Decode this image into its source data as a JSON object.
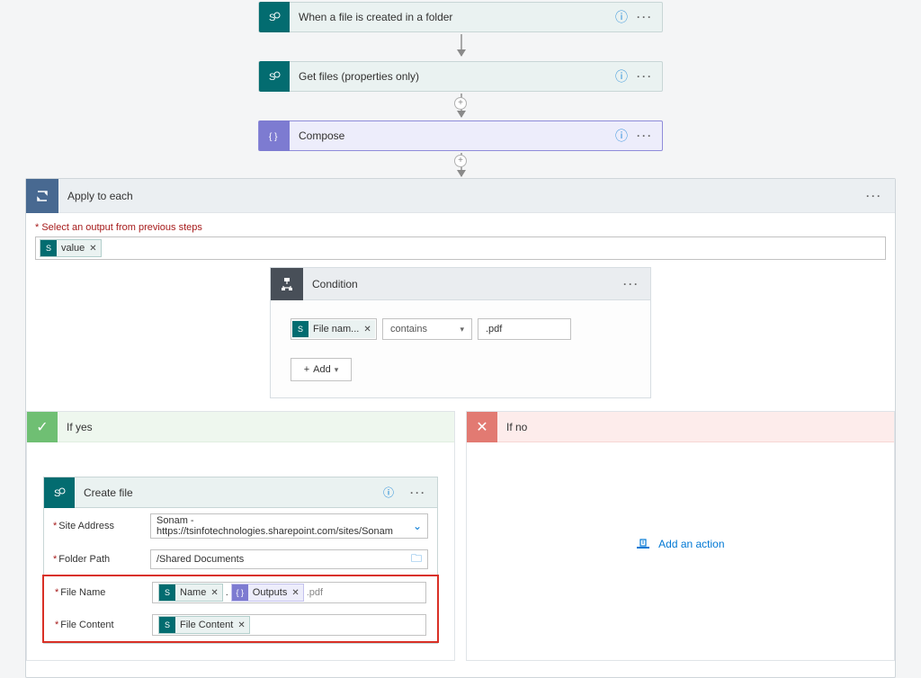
{
  "steps": {
    "trigger": "When a file is created in a folder",
    "getfiles": "Get files (properties only)",
    "compose": "Compose"
  },
  "foreach": {
    "title": "Apply to each",
    "output_label": "Select an output from previous steps",
    "token_value": "value"
  },
  "condition": {
    "title": "Condition",
    "field_token": "File nam...",
    "operator": "contains",
    "value": ".pdf",
    "add": "Add"
  },
  "branch": {
    "yes": "If yes",
    "no": "If no"
  },
  "createfile": {
    "title": "Create file",
    "site_label": "Site Address",
    "site_value": "Sonam - https://tsinfotechnologies.sharepoint.com/sites/Sonam",
    "folder_label": "Folder Path",
    "folder_value": "/Shared Documents",
    "filename_label": "File Name",
    "filename_token1": "Name",
    "filename_dot": ".",
    "filename_token2": "Outputs",
    "filename_suffix": ".pdf",
    "content_label": "File Content",
    "content_token": "File Content"
  },
  "add_action": "Add an action"
}
